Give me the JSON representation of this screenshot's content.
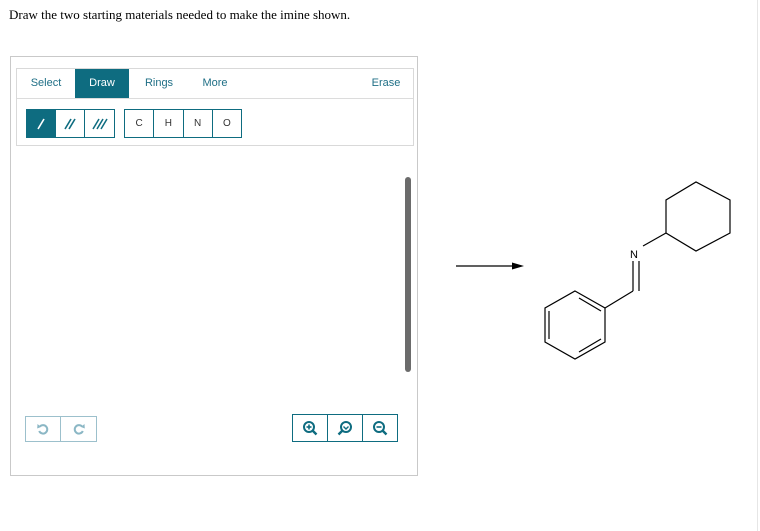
{
  "question": "Draw the two starting materials needed to make the imine shown.",
  "toolbar": {
    "tabs": [
      "Select",
      "Draw",
      "Rings",
      "More",
      "Erase"
    ],
    "active_tab": "Draw",
    "bond_tools": [
      {
        "name": "single-bond",
        "active": true
      },
      {
        "name": "double-bond",
        "active": false
      },
      {
        "name": "triple-bond",
        "active": false
      }
    ],
    "atoms": [
      "C",
      "H",
      "N",
      "O"
    ]
  },
  "history": {
    "undo_icon": "undo-icon",
    "redo_icon": "redo-icon"
  },
  "zoom": {
    "zoom_in_icon": "zoom-in-icon",
    "reset_icon": "zoom-reset-icon",
    "zoom_out_icon": "zoom-out-icon"
  },
  "product": {
    "heteroatom_label": "N"
  },
  "colors": {
    "accent": "#0e6c80",
    "tab_text": "#1f6f86"
  }
}
